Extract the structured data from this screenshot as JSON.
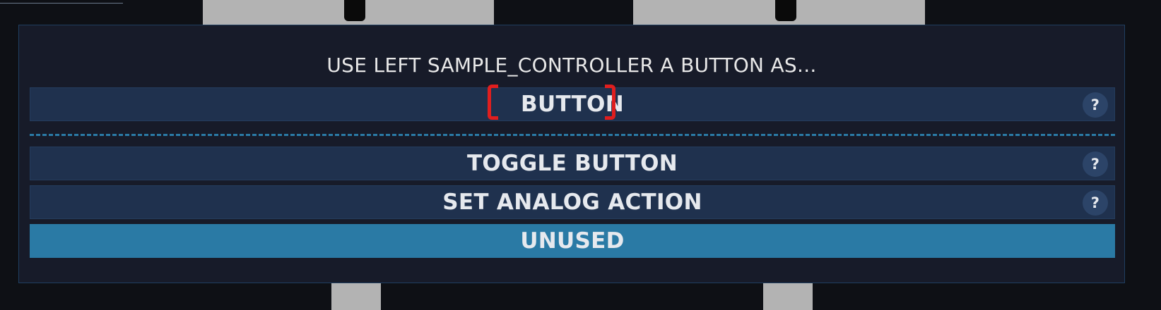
{
  "dialog": {
    "title": "USE LEFT SAMPLE_CONTROLLER A BUTTON AS...",
    "help_label": "?",
    "options": [
      {
        "label": "BUTTON",
        "has_help": true,
        "selected": false,
        "highlighted": true
      },
      {
        "label": "TOGGLE BUTTON",
        "has_help": true,
        "selected": false
      },
      {
        "label": "SET ANALOG ACTION",
        "has_help": true,
        "selected": false
      },
      {
        "label": "UNUSED",
        "has_help": false,
        "selected": true
      }
    ]
  },
  "colors": {
    "background": "#0e1015",
    "dialog": "#171b29",
    "option": "#1f314e",
    "selected_option": "#2a7aa5",
    "highlight_bracket": "#e01e1e"
  }
}
